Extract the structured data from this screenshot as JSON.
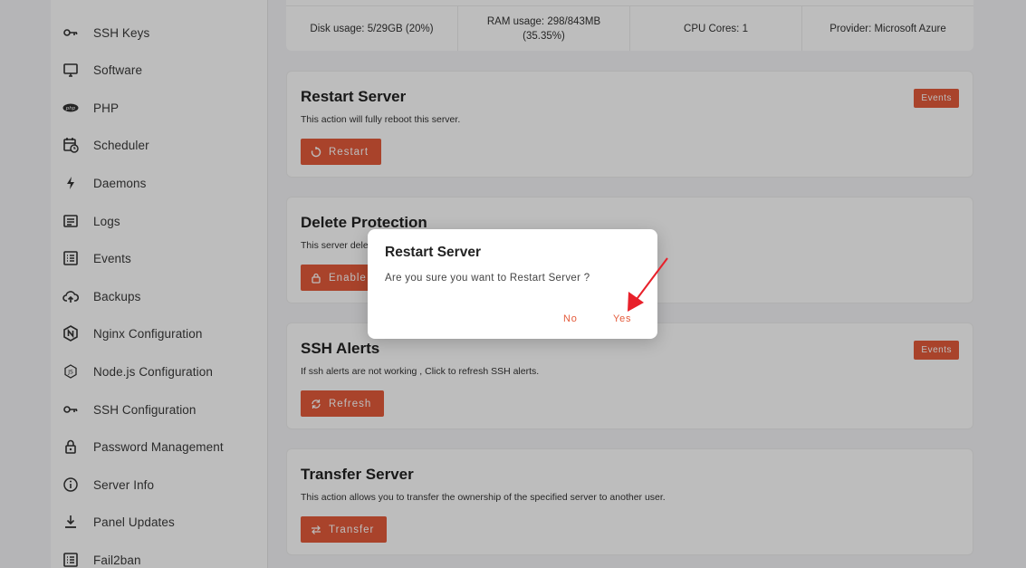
{
  "sidebar": {
    "items": [
      {
        "label": "SSH Keys",
        "icon": "key-icon"
      },
      {
        "label": "Software",
        "icon": "monitor-icon"
      },
      {
        "label": "PHP",
        "icon": "php-icon"
      },
      {
        "label": "Scheduler",
        "icon": "calendar-clock-icon"
      },
      {
        "label": "Daemons",
        "icon": "bolt-icon"
      },
      {
        "label": "Logs",
        "icon": "log-icon"
      },
      {
        "label": "Events",
        "icon": "list-icon"
      },
      {
        "label": "Backups",
        "icon": "cloud-upload-icon"
      },
      {
        "label": "Nginx Configuration",
        "icon": "nginx-icon"
      },
      {
        "label": "Node.js Configuration",
        "icon": "nodejs-icon"
      },
      {
        "label": "SSH Configuration",
        "icon": "key-icon"
      },
      {
        "label": "Password Management",
        "icon": "lock-icon"
      },
      {
        "label": "Server Info",
        "icon": "info-icon"
      },
      {
        "label": "Panel Updates",
        "icon": "download-icon"
      },
      {
        "label": "Fail2ban",
        "icon": "list-icon"
      }
    ]
  },
  "stats": {
    "disk": "Disk usage: 5/29GB (20%)",
    "ram_line1": "RAM usage: 298/843MB",
    "ram_line2": "(35.35%)",
    "cpu": "CPU Cores: 1",
    "provider": "Provider: Microsoft Azure"
  },
  "cards": {
    "restart": {
      "title": "Restart Server",
      "desc": "This action will fully reboot this server.",
      "button": "Restart",
      "badge": "Events"
    },
    "delete_protection": {
      "title": "Delete Protection",
      "desc": "This server delete protection is disabled.",
      "button": "Enable"
    },
    "ssh_alerts": {
      "title": "SSH Alerts",
      "desc": "If ssh alerts are not working , Click to refresh SSH alerts.",
      "button": "Refresh",
      "badge": "Events"
    },
    "transfer": {
      "title": "Transfer Server",
      "desc": "This action allows you to transfer the ownership of the specified server to another user.",
      "button": "Transfer"
    }
  },
  "modal": {
    "title": "Restart Server",
    "message": "Are you sure you want to Restart Server ?",
    "no": "No",
    "yes": "Yes"
  },
  "colors": {
    "accent": "#e45b3b",
    "annotation_arrow": "#e8202a"
  }
}
